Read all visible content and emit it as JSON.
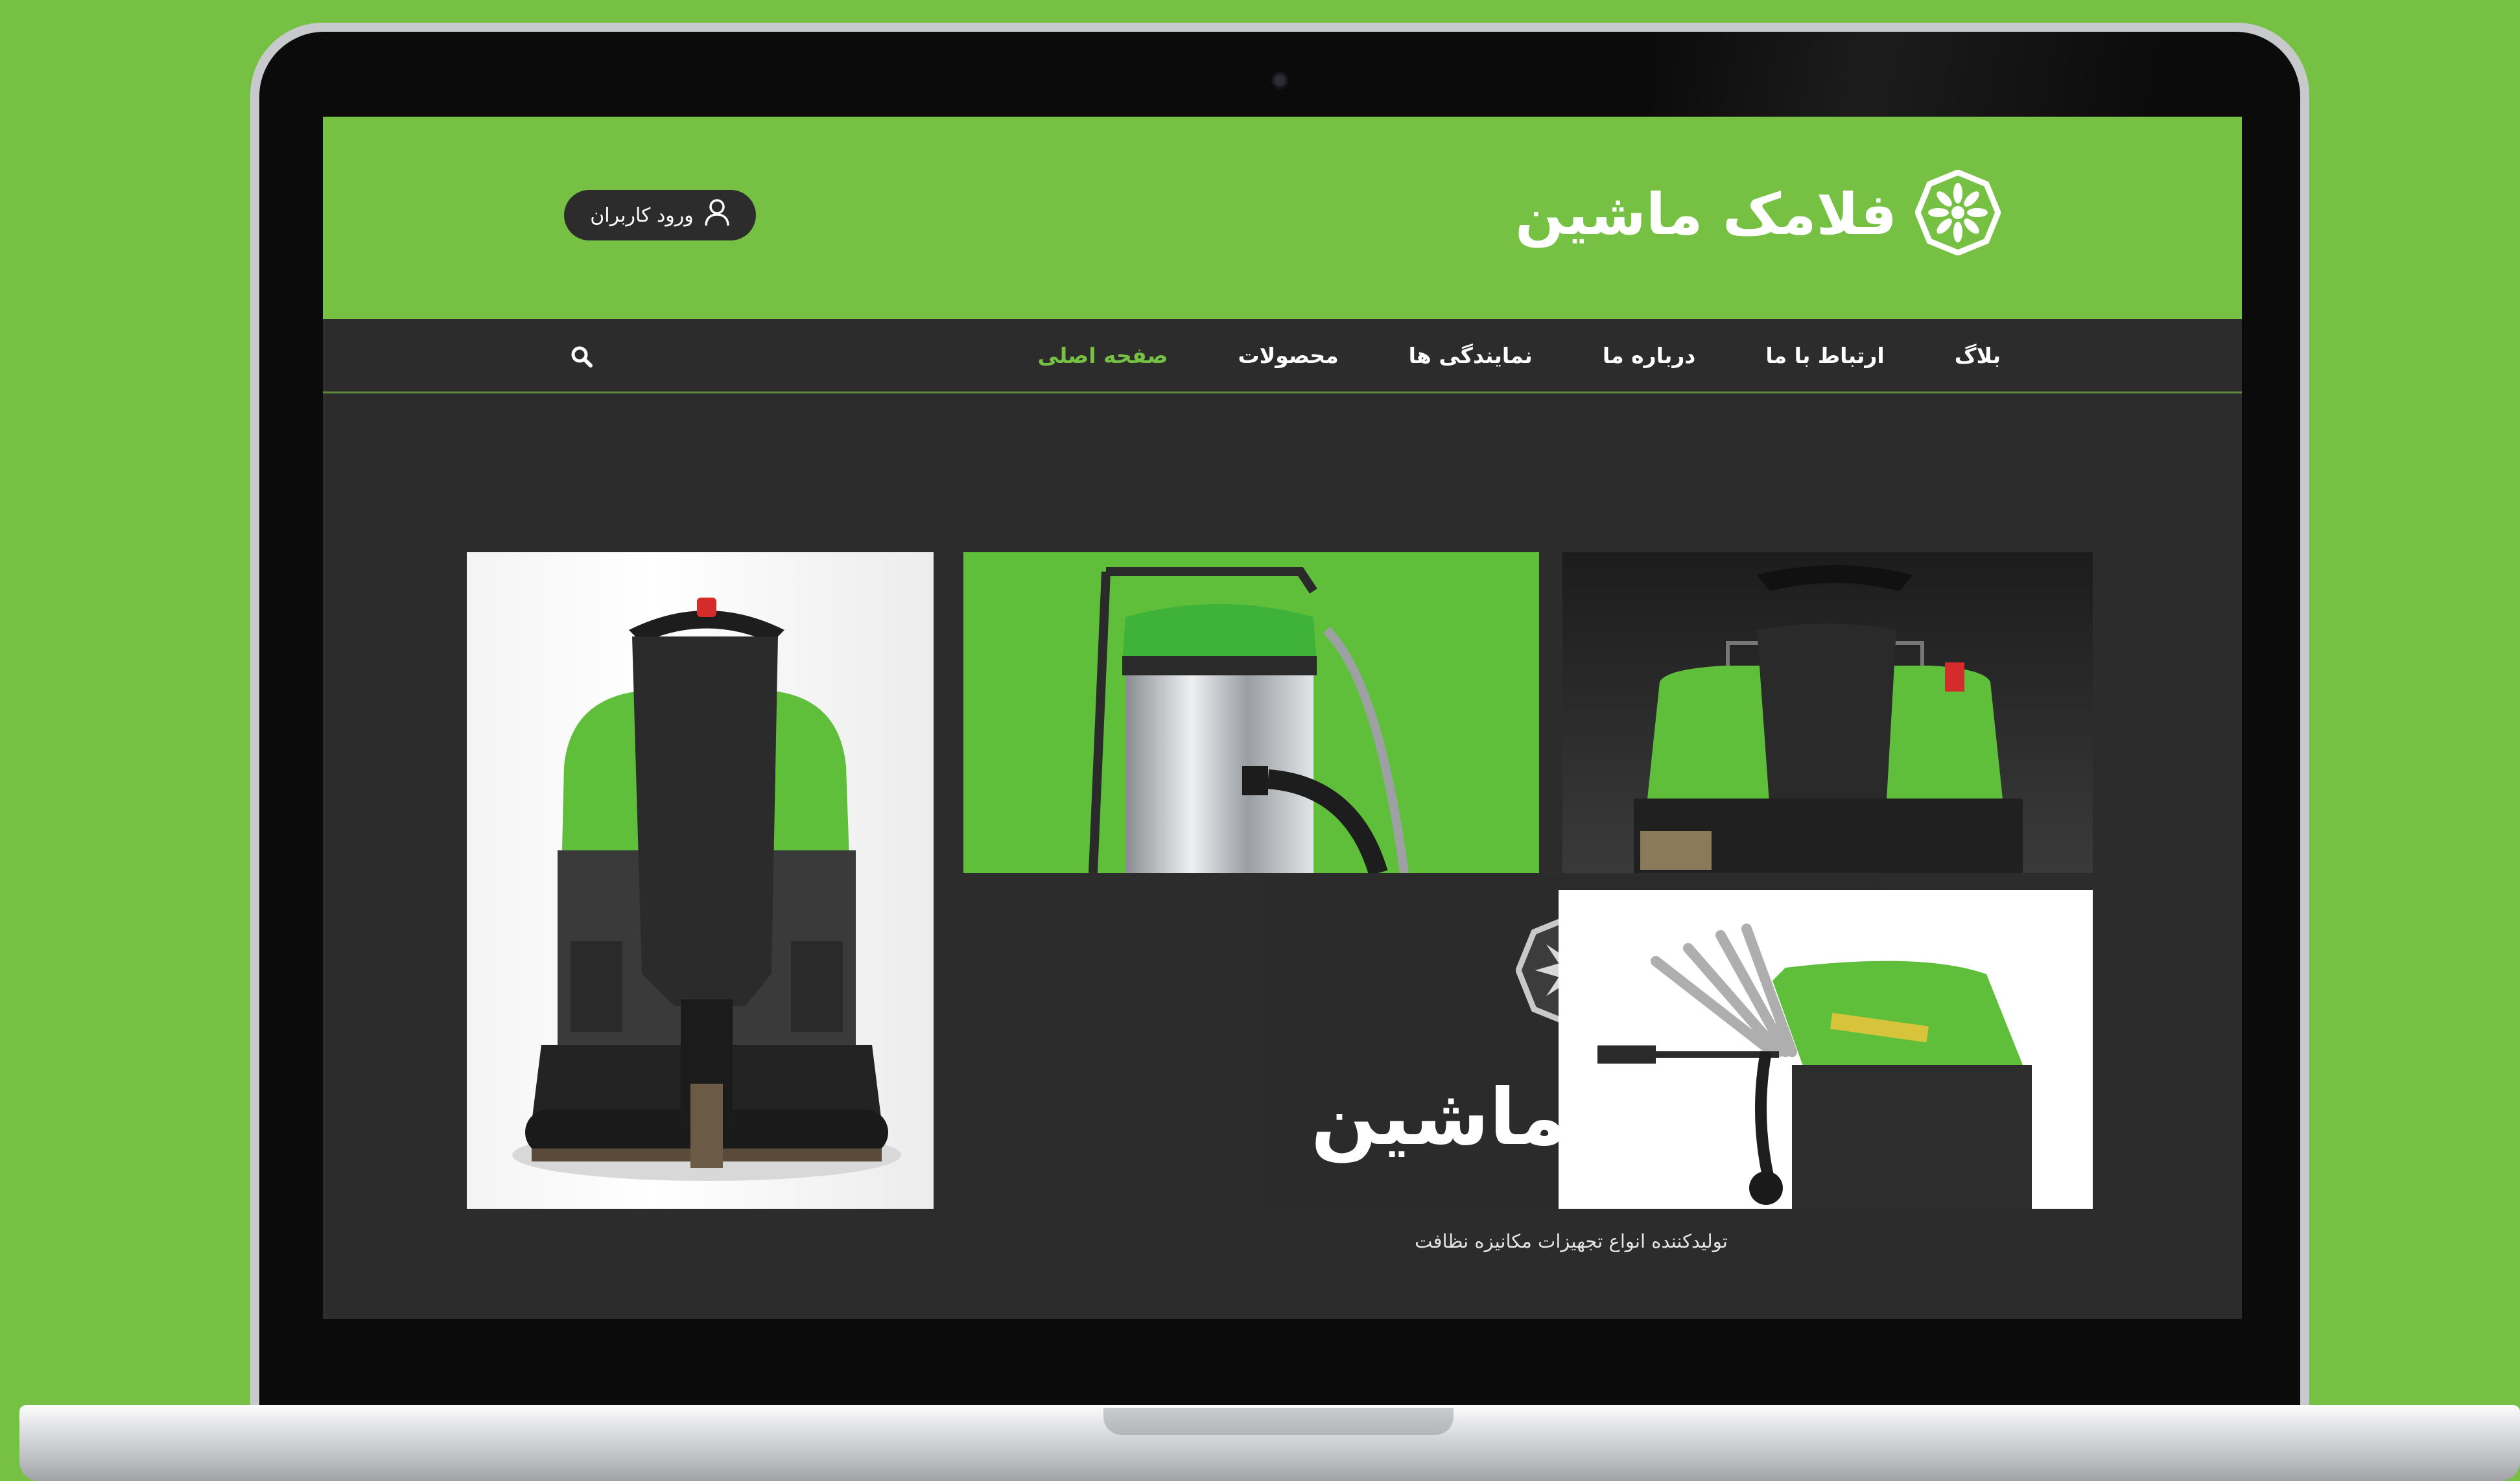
{
  "site": {
    "logo_text": "فلامک ماشین",
    "login_label": "ورود کاربران"
  },
  "nav": {
    "items": [
      {
        "label": "صفحه اصلی",
        "active": true
      },
      {
        "label": "محصولات",
        "active": false
      },
      {
        "label": "نمایندگی ها",
        "active": false
      },
      {
        "label": "درباره ما",
        "active": false
      },
      {
        "label": "ارتباط با ما",
        "active": false
      },
      {
        "label": "بلاگ",
        "active": false
      }
    ]
  },
  "hero": {
    "brand_name": "فلامک ماشین",
    "tagline": "تولیدکننده انواع تجهیزات مکانیزه نظافت"
  },
  "colors": {
    "brand_green": "#76c043",
    "dark": "#2c2c2c"
  },
  "icons": [
    "logo-icon",
    "user-icon",
    "search-icon"
  ]
}
